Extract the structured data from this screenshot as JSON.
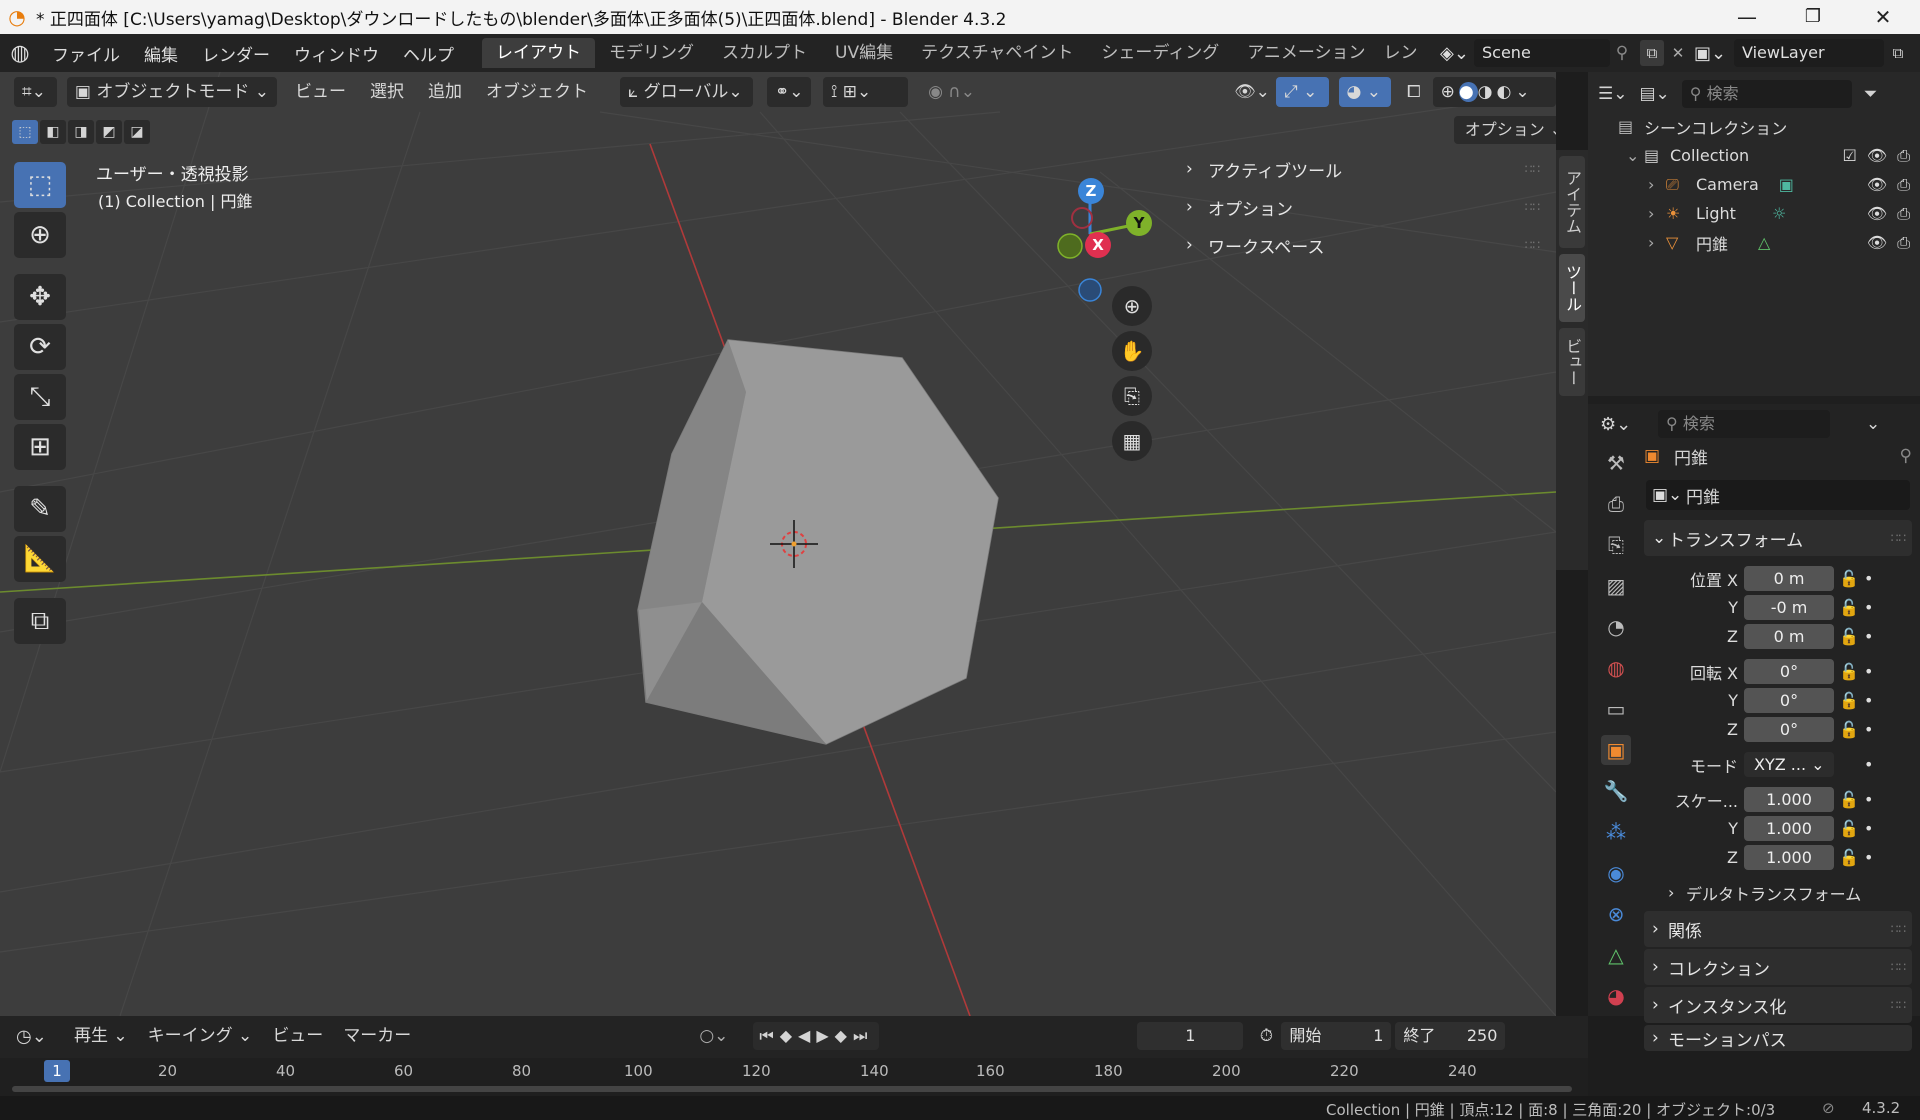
{
  "window": {
    "title": "* 正四面体 [C:\\Users\\yamag\\Desktop\\ダウンロードしたもの\\blender\\多面体\\正多面体(5)\\正四面体.blend] - Blender 4.3.2",
    "minimize": "—",
    "maximize": "❐",
    "close": "✕"
  },
  "menubar": {
    "menus": [
      "ファイル",
      "編集",
      "レンダー",
      "ウィンドウ",
      "ヘルプ"
    ],
    "workspaces": [
      "レイアウト",
      "モデリング",
      "スカルプト",
      "UV編集",
      "テクスチャペイント",
      "シェーディング",
      "アニメーション",
      "レン"
    ],
    "active_workspace": 0,
    "scene": "Scene",
    "viewlayer": "ViewLayer"
  },
  "viewport_header": {
    "mode": "オブジェクトモード",
    "menus": [
      "ビュー",
      "選択",
      "追加",
      "オブジェクト"
    ],
    "orientation": "グローバル",
    "options": "オプション"
  },
  "viewport": {
    "view_name": "ユーザー・透視投影",
    "collection_info": "(1) Collection | 円錐",
    "gizmo": {
      "z": "Z",
      "y": "Y",
      "x": "X"
    }
  },
  "npanel": {
    "sections": [
      "アクティブツール",
      "オプション",
      "ワークスペース"
    ],
    "tabs": [
      "アイテム",
      "ツール",
      "ビュー"
    ]
  },
  "outliner": {
    "search_placeholder": "検索",
    "root": "シーンコレクション",
    "collection": "Collection",
    "items": [
      "Camera",
      "Light",
      "円錐"
    ]
  },
  "properties": {
    "search_placeholder": "検索",
    "object_name": "円錐",
    "data_name": "円錐",
    "transform_header": "トランスフォーム",
    "location_label": "位置 X",
    "location": [
      "0 m",
      "-0 m",
      "0 m"
    ],
    "rotation_label": "回転 X",
    "rotation": [
      "0°",
      "0°",
      "0°"
    ],
    "mode_label": "モード",
    "mode_value": "XYZ ...",
    "scale_label": "スケー...",
    "scale": [
      "1.000",
      "1.000",
      "1.000"
    ],
    "axis_y": "Y",
    "axis_z": "Z",
    "delta_transform": "デルタトランスフォーム",
    "sections": [
      "関係",
      "コレクション",
      "インスタンス化",
      "モーションパス"
    ]
  },
  "timeline": {
    "menus": [
      "再生",
      "キーイング",
      "ビュー",
      "マーカー"
    ],
    "current_frame": "1",
    "start_label": "開始",
    "start": "1",
    "end_label": "終了",
    "end": "250",
    "ruler": [
      "20",
      "40",
      "60",
      "80",
      "100",
      "120",
      "140",
      "160",
      "180",
      "200",
      "220",
      "240"
    ],
    "ruler_current": "1"
  },
  "statusbar": {
    "text": "Collection | 円錐 | 頂点:12 | 面:8 | 三角面:20 | オブジェクト:0/3",
    "version": "4.3.2"
  }
}
